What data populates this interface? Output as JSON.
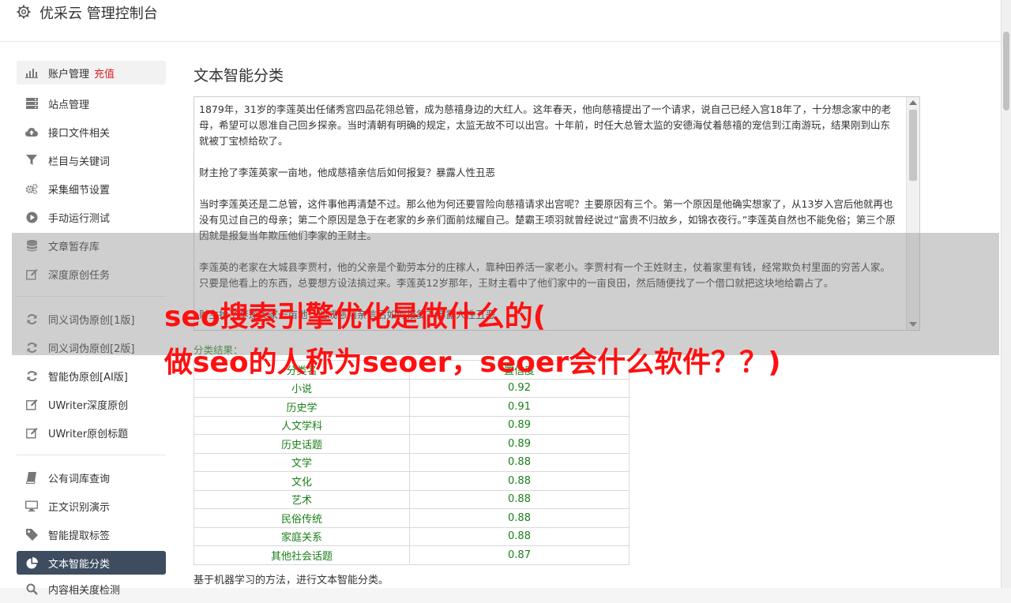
{
  "header": {
    "title": "优采云 管理控制台"
  },
  "sidebar": {
    "items": [
      {
        "label": "账户管理",
        "badge": "充值",
        "icon": "bar-chart-icon",
        "name": "sidebar-item-account"
      },
      {
        "label": "站点管理",
        "icon": "server-icon",
        "name": "sidebar-item-sites"
      },
      {
        "label": "接口文件相关",
        "icon": "cloud-upload-icon",
        "name": "sidebar-item-api-files"
      },
      {
        "label": "栏目与关键词",
        "icon": "filter-icon",
        "name": "sidebar-item-columns-keywords"
      },
      {
        "label": "采集细节设置",
        "icon": "gears-icon",
        "name": "sidebar-item-collect-settings"
      },
      {
        "label": "手动运行测试",
        "icon": "play-circle-icon",
        "name": "sidebar-item-manual-run"
      },
      {
        "label": "文章暂存库",
        "icon": "database-icon",
        "name": "sidebar-item-article-store"
      },
      {
        "label": "深度原创任务",
        "icon": "edit-icon",
        "name": "sidebar-item-deep-original"
      },
      {
        "label": "同义词伪原创[1版]",
        "icon": "refresh-icon",
        "name": "sidebar-item-synonym-v1"
      },
      {
        "label": "同义词伪原创[2版]",
        "icon": "refresh-icon",
        "name": "sidebar-item-synonym-v2"
      },
      {
        "label": "智能伪原创[AI版]",
        "icon": "refresh-icon",
        "name": "sidebar-item-ai-rewrite"
      },
      {
        "label": "UWriter深度原创",
        "icon": "edit-icon",
        "name": "sidebar-item-uwriter-deep"
      },
      {
        "label": "UWriter原创标题",
        "icon": "edit-icon",
        "name": "sidebar-item-uwriter-title"
      },
      {
        "label": "公有词库查询",
        "icon": "book-icon",
        "name": "sidebar-item-public-lexicon"
      },
      {
        "label": "正文识别演示",
        "icon": "monitor-icon",
        "name": "sidebar-item-body-detect"
      },
      {
        "label": "智能提取标签",
        "icon": "tag-icon",
        "name": "sidebar-item-extract-tags"
      },
      {
        "label": "文本智能分类",
        "icon": "pie-chart-icon",
        "name": "sidebar-item-text-classify"
      },
      {
        "label": "内容相关度检测",
        "icon": "search-icon",
        "name": "sidebar-item-relevance"
      }
    ]
  },
  "main": {
    "title": "文本智能分类",
    "text": "1879年，31岁的李莲英出任储秀宫四品花翎总管，成为慈禧身边的大红人。这年春天，他向慈禧提出了一个请求，说自己已经入宫18年了，十分想念家中的老母，希望可以恩准自己回乡探亲。当时清朝有明确的规定，太监无故不可以出宫。十年前，时任大总管太监的安德海仗着慈禧的宠信到江南游玩，结果刚到山东就被丁宝桢给砍了。\n\n财主抢了李莲英家一亩地，他成慈禧亲信后如何报复？暴露人性丑恶\n\n当时李莲英还是二总管，这件事他再清楚不过。那么他为何还要冒险向慈禧请求出宫呢？主要原因有三个。第一个原因是他确实想家了，从13岁入宫后他就再也没有见过自己的母亲；第二个原因是急于在老家的乡亲们面前炫耀自己。楚霸王项羽就曾经说过“富贵不归故乡，如锦衣夜行。”李莲英自然也不能免俗；第三个原因就是报复当年欺压他们李家的王财主。\n\n李莲英的老家在大城县李贾村，他的父亲是个勤劳本分的庄稼人，靠种田养活一家老小。李贾村有一个王姓财主，仗着家里有钱，经常欺负村里面的穷苦人家。只要是他看上的东西，总要想方设法搞过来。李莲英12岁那年，王财主看中了他们家中的一亩良田，然后随便找了一个借口就把这块地给霸占了。\n\n财主抢了李莲英家一亩地，他成慈禧亲信后如何报复？暴露人性丑恶",
    "result_label": "分类结果：",
    "table": {
      "headers": [
        "分类名",
        "置信度"
      ],
      "rows": [
        [
          "小说",
          "0.92"
        ],
        [
          "历史学",
          "0.91"
        ],
        [
          "人文学科",
          "0.89"
        ],
        [
          "历史话题",
          "0.89"
        ],
        [
          "文学",
          "0.88"
        ],
        [
          "文化",
          "0.88"
        ],
        [
          "艺术",
          "0.88"
        ],
        [
          "民俗传统",
          "0.88"
        ],
        [
          "家庭关系",
          "0.88"
        ],
        [
          "其他社会话题",
          "0.87"
        ]
      ]
    },
    "footnote": "基于机器学习的方法，进行文本智能分类。"
  },
  "watermark": {
    "line1": "seo搜索引擎优化是做什么的(",
    "line2": "做seo的人称为seoer，seoer会什么软件？？)"
  },
  "colors": {
    "active_nav": "#3d4d5f",
    "badge": "#e02020",
    "result_green": "#1a7f1a",
    "watermark": "#ff1010"
  }
}
